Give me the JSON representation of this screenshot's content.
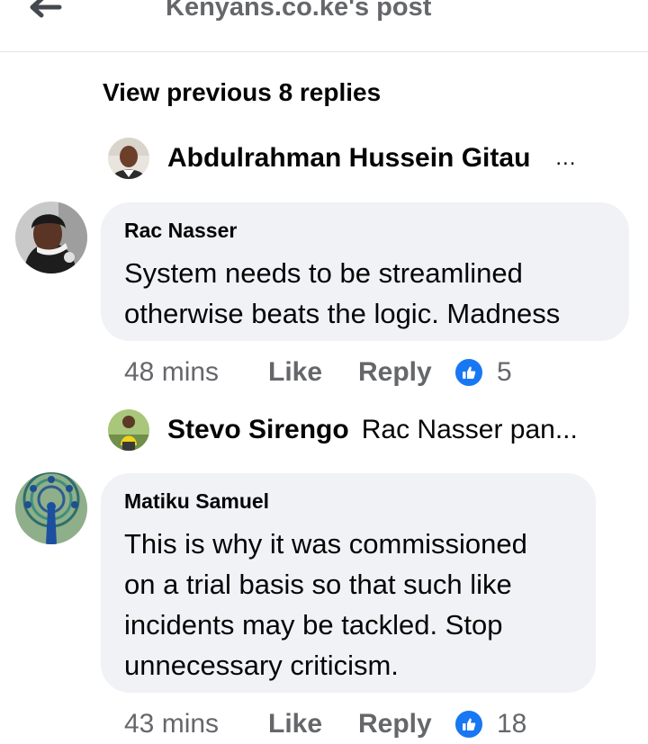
{
  "header": {
    "title": "Kenyans.co.ke's post",
    "back_icon": "back-arrow-icon"
  },
  "thread": {
    "view_previous_label": "View previous 8 replies"
  },
  "reply_previews": [
    {
      "name": "Abdulrahman Hussein Gitau",
      "text": "",
      "more": "..."
    },
    {
      "name": "Stevo Sirengo",
      "text": "Rac Nasser pan...",
      "more": ""
    }
  ],
  "comments": [
    {
      "author": "Rac Nasser",
      "text": "System needs to be streamlined\notherwise beats the logic. Madness",
      "time": "48 mins",
      "like_label": "Like",
      "reply_label": "Reply",
      "reaction_count": "5"
    },
    {
      "author": "Matiku Samuel",
      "text": "This is why it was commissioned\non a trial basis so that such like\nincidents may be tackled. Stop\nunnecessary criticism.",
      "time": "43 mins",
      "like_label": "Like",
      "reply_label": "Reply",
      "reaction_count": "18"
    }
  ],
  "colors": {
    "accent": "#1877f2",
    "bubble": "#f0f2f5",
    "muted_text": "#65676b"
  }
}
